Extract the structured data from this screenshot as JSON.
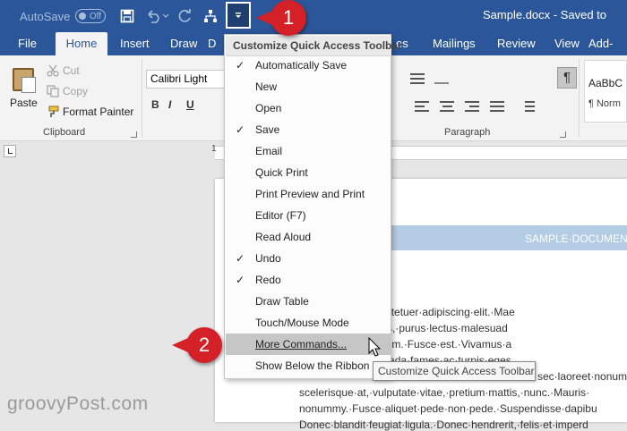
{
  "titlebar": {
    "autosave_label": "AutoSave",
    "autosave_state": "Off",
    "doc_title": "Sample.docx  -  Saved to"
  },
  "callouts": {
    "one": "1",
    "two": "2"
  },
  "tabs": {
    "file": "File",
    "home": "Home",
    "insert": "Insert",
    "draw": "Draw",
    "design": "D",
    "references_tail": "es",
    "mailings": "Mailings",
    "review": "Review",
    "view": "View",
    "addins": "Add-"
  },
  "ribbon": {
    "paste": "Paste",
    "cut": "Cut",
    "copy": "Copy",
    "format_painter": "Format Painter",
    "clipboard": "Clipboard",
    "font_name": "Calibri Light",
    "bold": "B",
    "italic": "I",
    "underline": "U",
    "paragraph": "Paragraph",
    "pilcrow": "¶",
    "style_sample": "AaBbC",
    "style_normal": "¶ Norm"
  },
  "ruler": {
    "number": "1"
  },
  "menu": {
    "title": "Customize Quick Access Toolbar",
    "items": [
      {
        "label": "Automatically Save",
        "check": "✓"
      },
      {
        "label": "New",
        "check": ""
      },
      {
        "label": "Open",
        "check": ""
      },
      {
        "label": "Save",
        "check": "✓"
      },
      {
        "label": "Email",
        "check": ""
      },
      {
        "label": "Quick Print",
        "check": ""
      },
      {
        "label": "Print Preview and Print",
        "check": ""
      },
      {
        "label": "Editor (F7)",
        "check": ""
      },
      {
        "label": "Read Aloud",
        "check": ""
      },
      {
        "label": "Undo",
        "check": "✓"
      },
      {
        "label": "Redo",
        "check": "✓"
      },
      {
        "label": "Draw Table",
        "check": ""
      },
      {
        "label": "Touch/Mouse Mode",
        "check": ""
      },
      {
        "label": "More Commands...",
        "check": ""
      },
      {
        "label": "Show Below the Ribbon",
        "check": ""
      }
    ]
  },
  "tooltip": "Customize Quick Access Toolbar",
  "document": {
    "banner": "SAMPLE·DOCUMEN",
    "lines": [
      "or·sit·amet,·consectetuer·adipiscing·elit.·Mae",
      "ed·pulvinar·ultricies,·purus·lectus·malesuad",
      "iverra·imperdiet·enim.·Fusce·est.·Vivamus·a",
      "et·netus·et·malesuada·fames·ac·turpis·eges",
      "sec·laoreet·nonum",
      "scelerisque·at,·vulputate·vitae,·pretium·mattis,·nunc.·Mauris·",
      "nonummy.·Fusce·aliquet·pede·non·pede.·Suspendisse·dapibu",
      "Donec·blandit·feugiat·ligula.·Donec·hendrerit,·felis·et·imperd"
    ]
  },
  "watermark": "groovyPost.com",
  "colors": {
    "brand": "#2b579a",
    "callout": "#d42027",
    "banner": "#b4cde4"
  }
}
